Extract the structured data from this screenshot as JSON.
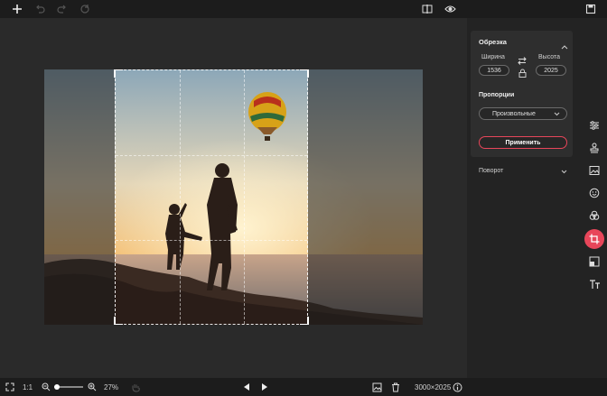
{
  "toolbar": {
    "icons": [
      "plus-icon",
      "undo-icon",
      "redo-icon",
      "reset-icon",
      "compare-icon",
      "eye-icon",
      "save-icon"
    ]
  },
  "crop_panel": {
    "title": "Обрезка",
    "width_label": "Ширина",
    "height_label": "Высота",
    "width_value": "1536",
    "height_value": "2025",
    "proportion_label": "Пропорции",
    "proportion_value": "Произвольные",
    "apply_label": "Применить"
  },
  "rotate_panel": {
    "title": "Поворот"
  },
  "bottom": {
    "ratio_label": "1:1",
    "zoom_value": "27%",
    "dimensions": "3000×2025"
  },
  "colors": {
    "accent": "#e8465a",
    "panel_bg": "#2e2e2e",
    "bar_bg": "#1c1c1c"
  }
}
